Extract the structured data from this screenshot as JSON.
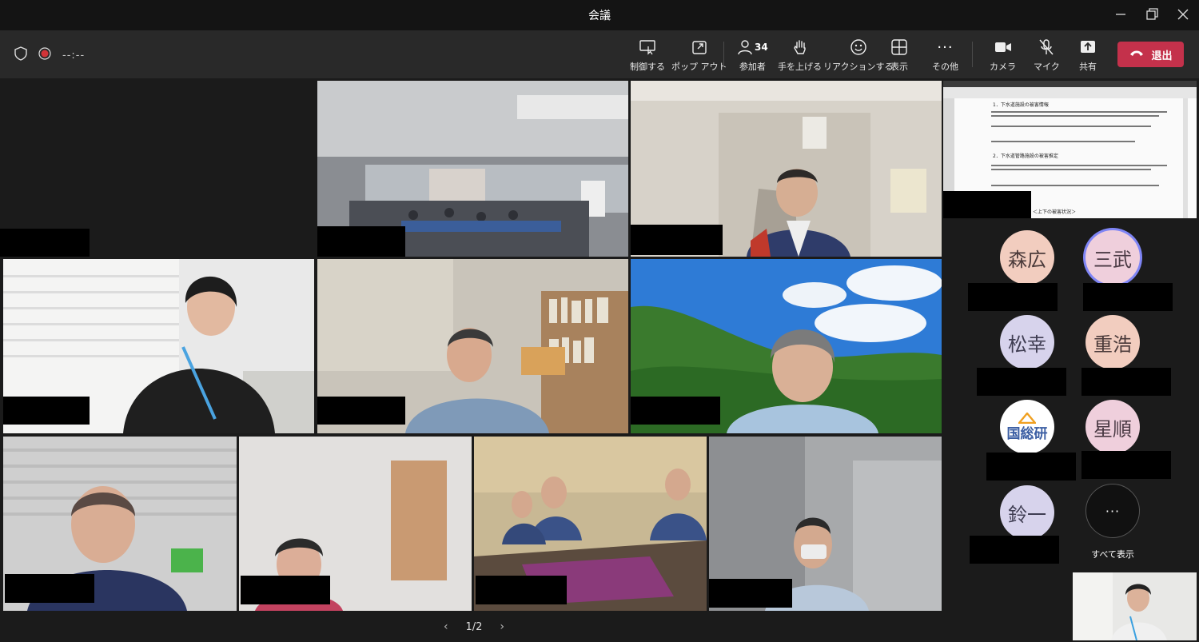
{
  "window": {
    "title": "会議"
  },
  "toolbar": {
    "timer": "--:--",
    "buttons": [
      {
        "label": "制御する",
        "icon": "control-screen-icon"
      },
      {
        "label": "ポップ アウト",
        "icon": "pop-out-icon"
      },
      {
        "label": "参加者",
        "icon": "people-icon",
        "count": "34"
      },
      {
        "label": "手を上げる",
        "icon": "raise-hand-icon"
      },
      {
        "label": "リアクションする",
        "icon": "reaction-icon"
      },
      {
        "label": "表示",
        "icon": "layout-grid-icon"
      },
      {
        "label": "その他",
        "icon": "more-icon"
      },
      {
        "label": "カメラ",
        "icon": "camera-icon"
      },
      {
        "label": "マイク",
        "icon": "mic-off-icon"
      },
      {
        "label": "共有",
        "icon": "share-icon"
      }
    ],
    "leave_label": "退出"
  },
  "participants": [
    {
      "initials": "森広"
    },
    {
      "initials": "三武"
    },
    {
      "initials": "松幸"
    },
    {
      "initials": "重浩"
    },
    {
      "initials": "国総研"
    },
    {
      "initials": "星順"
    },
    {
      "initials": "鈴一"
    }
  ],
  "show_all_label": "すべて表示",
  "pager": {
    "page": "1/2"
  },
  "shared_document": {
    "heading1": "1．下水道施設の被害情報",
    "heading2": "2．下水道管路施設の被害推定",
    "bottom_line": "＜上下の被害状況＞"
  }
}
